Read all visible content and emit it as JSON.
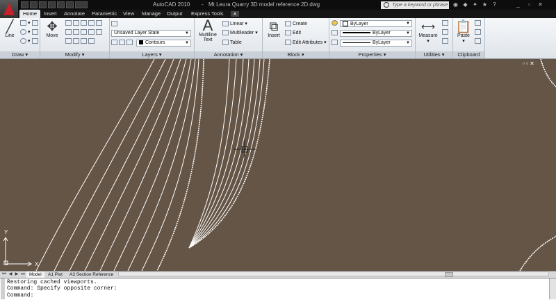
{
  "window": {
    "app_name": "AutoCAD 2010",
    "separator": "-",
    "file_name": "Mt Leura Quarry 3D model reference 2D.dwg",
    "search_placeholder": "Type a keyword or phrase"
  },
  "tabs": [
    {
      "label": "Home",
      "active": true
    },
    {
      "label": "Insert",
      "active": false
    },
    {
      "label": "Annotate",
      "active": false
    },
    {
      "label": "Parametric",
      "active": false
    },
    {
      "label": "View",
      "active": false
    },
    {
      "label": "Manage",
      "active": false
    },
    {
      "label": "Output",
      "active": false
    },
    {
      "label": "Express Tools",
      "active": false
    }
  ],
  "ribbon": {
    "draw": {
      "title": "Draw",
      "line": "Line"
    },
    "modify": {
      "title": "Modify",
      "move": "Move"
    },
    "layers": {
      "title": "Layers",
      "layer_state": "Unsaved Layer State",
      "current_layer": "Contours"
    },
    "annotation": {
      "title": "Annotation",
      "multiline_text": "Multiline",
      "text": "Text",
      "linear": "Linear",
      "multileader": "Multileader",
      "table": "Table"
    },
    "block": {
      "title": "Block",
      "insert": "Insert",
      "create": "Create",
      "edit": "Edit",
      "edit_attributes": "Edit Attributes"
    },
    "properties": {
      "title": "Properties",
      "color": "ByLayer",
      "linetype": "ByLayer",
      "lineweight": "ByLayer"
    },
    "utilities": {
      "title": "Utilities",
      "measure": "Measure"
    },
    "clipboard": {
      "title": "Clipboard",
      "paste": "Paste"
    }
  },
  "layout_tabs": [
    {
      "label": "Model",
      "active": true
    },
    {
      "label": "A1 Plot",
      "active": false
    },
    {
      "label": "A3 Section Reference",
      "active": false
    }
  ],
  "ucs": {
    "x": "X",
    "y": "Y"
  },
  "command_line": [
    "Restoring cached viewports.",
    "Command: Specify opposite corner:",
    "Command:"
  ],
  "colors": {
    "canvas_bg": "#655546",
    "title_bar": "#0d0d0d",
    "ribbon_bg": "#e6eaee",
    "app_logo": "#c8202a"
  }
}
